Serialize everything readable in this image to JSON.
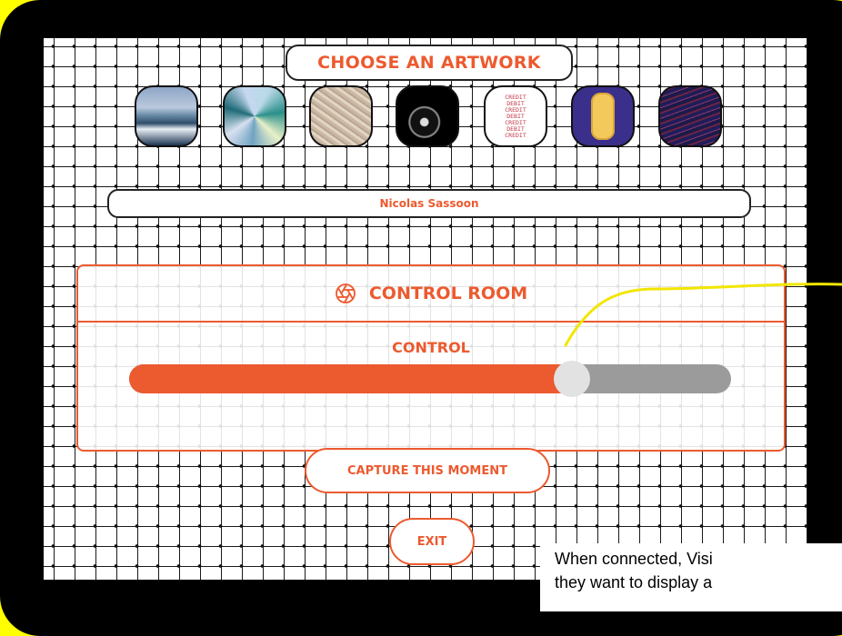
{
  "header": {
    "title": "CHOOSE AN ARTWORK"
  },
  "artworks": [
    {
      "name": "coastline-artwork"
    },
    {
      "name": "iridescent-artwork"
    },
    {
      "name": "sand-texture-artwork"
    },
    {
      "name": "dark-abstract-artwork"
    },
    {
      "name": "credit-debit-artwork",
      "lines": [
        "CREDIT",
        "DEBIT",
        "CREDIT",
        "DEBIT",
        "CREDIT",
        "DEBIT",
        "CREDIT"
      ]
    },
    {
      "name": "golden-wave-artwork"
    },
    {
      "name": "purple-waves-artwork"
    }
  ],
  "selected_artist": "Nicolas Sassoon",
  "control_room": {
    "title": "CONTROL ROOM",
    "icon": "aperture-icon",
    "control_label": "CONTROL",
    "slider_value": 0.735
  },
  "buttons": {
    "capture": "CAPTURE THIS MOMENT",
    "exit": "EXIT"
  },
  "caption": {
    "line1": "When connected, Visi",
    "line2": "they want to display a"
  },
  "colors": {
    "accent": "#ec5a2f",
    "track": "#9b9b9b",
    "highlight": "#ffff00",
    "callout": "#f2e600"
  }
}
